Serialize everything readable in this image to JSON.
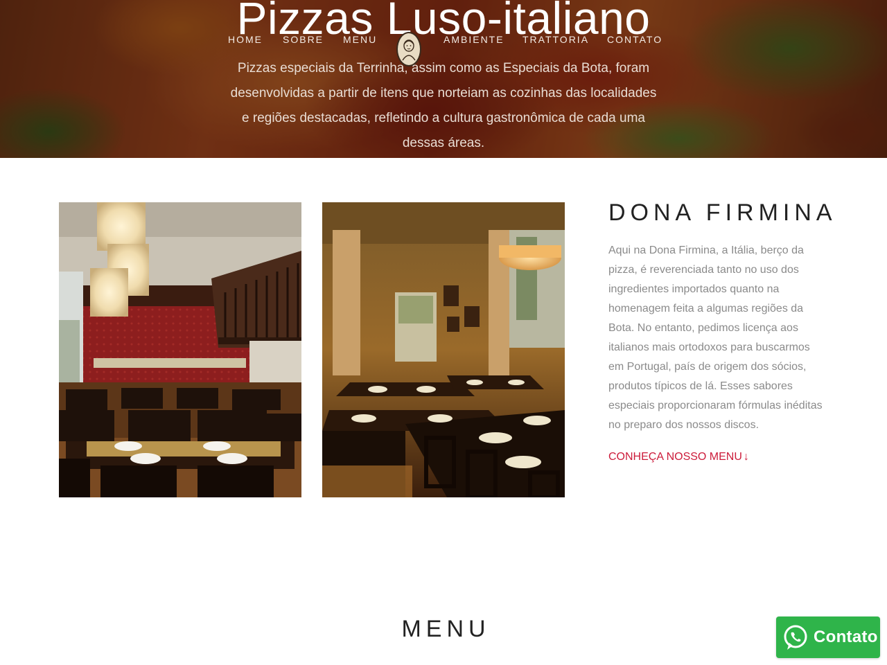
{
  "hero": {
    "title": "Pizzas Luso-italiano",
    "description": "Pizzas especiais da Terrinha, assim como as Especiais da Bota, foram desenvolvidas a partir de itens que norteiam as cozinhas das localidades e regiões destacadas, refletindo a cultura gastronômica de cada uma dessas áreas."
  },
  "nav": {
    "items": [
      {
        "label": "HOME"
      },
      {
        "label": "SOBRE"
      },
      {
        "label": "MENU"
      },
      {
        "label": "AMBIENTE"
      },
      {
        "label": "TRATTORIA"
      },
      {
        "label": "CONTATO"
      }
    ],
    "logo_icon": "dona-firmina-portrait-logo"
  },
  "about": {
    "heading": "DONA FIRMINA",
    "text": "Aqui na Dona Firmina, a Itália, berço da pizza, é reverenciada tanto no uso dos ingredientes importados quanto na homenagem feita a algumas regiões da Bota. No entanto, pedimos licença aos italianos mais ortodoxos para buscarmos em Portugal, país de origem dos sócios, produtos típicos de lá. Esses sabores especiais proporcionaram fórmulas inéditas no preparo dos nossos discos.",
    "link_label": "CONHEÇA NOSSO MENU",
    "link_icon": "arrow-down-icon"
  },
  "photos": [
    {
      "name": "restaurant-interior-red-wall-photo"
    },
    {
      "name": "restaurant-interior-dining-room-photo"
    }
  ],
  "menu_section": {
    "heading": "MENU"
  },
  "whatsapp": {
    "label": "Contato",
    "icon": "whatsapp-icon"
  },
  "colors": {
    "accent": "#cc1b3a",
    "heading": "#222222",
    "body_text": "#8a8a8a",
    "whatsapp_green": "#2fb44a"
  }
}
